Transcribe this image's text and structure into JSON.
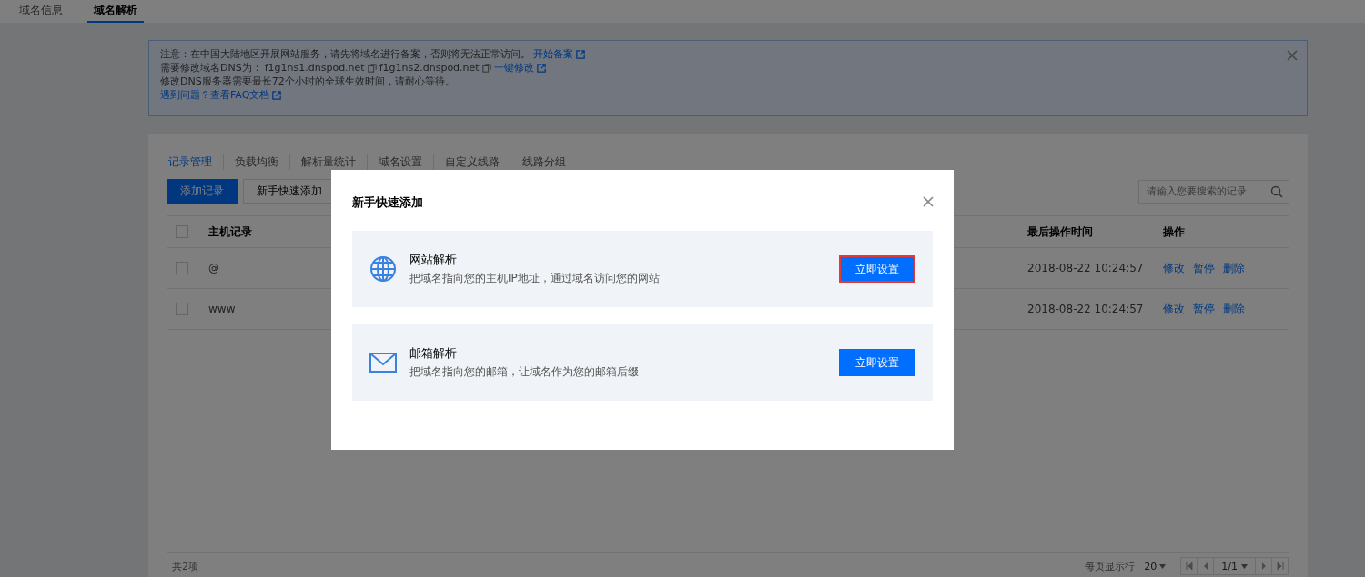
{
  "top_tabs": [
    {
      "label": "域名信息",
      "selected": false
    },
    {
      "label": "域名解析",
      "selected": true
    }
  ],
  "notice": {
    "lines": [
      {
        "text": "注意：在中国大陆地区开展网站服务，请先将域名进行备案，否则将无法正常访问。",
        "links": [
          "开始备案"
        ]
      },
      {
        "text": "需要修改域名DNS为：",
        "servers": [
          "f1g1ns1.dnspod.net",
          "f1g1ns2.dnspod.net"
        ],
        "links": [
          "一键修改"
        ]
      },
      {
        "text": "修改DNS服务器需要最长72个小时的全球生效时间，请耐心等待。"
      },
      {
        "links": [
          "遇到问题？查看FAQ文档"
        ]
      }
    ]
  },
  "sub_tabs": [
    {
      "label": "记录管理",
      "selected": true
    },
    {
      "label": "负载均衡",
      "selected": false
    },
    {
      "label": "解析量统计",
      "selected": false
    },
    {
      "label": "域名设置",
      "selected": false
    },
    {
      "label": "自定义线路",
      "selected": false
    },
    {
      "label": "线路分组",
      "selected": false
    }
  ],
  "toolbar": {
    "buttons": [
      {
        "label": "添加记录",
        "kind": "primary"
      },
      {
        "label": "新手快速添加",
        "kind": "default"
      }
    ],
    "search": {
      "placeholder": "请输入您要搜索的记录"
    }
  },
  "table": {
    "header_checked": false,
    "columns": [
      "主机记录",
      "最后操作时间",
      "操作"
    ],
    "rows": [
      {
        "checked": false,
        "host": "@",
        "time": "2018-08-22 10:24:57",
        "actions": [
          "修改",
          "暂停",
          "删除"
        ]
      },
      {
        "checked": false,
        "host": "www",
        "time": "2018-08-22 10:24:57",
        "actions": [
          "修改",
          "暂停",
          "删除"
        ]
      }
    ]
  },
  "footer": {
    "total": "共2项",
    "page_size_label": "每页显示行",
    "page_size": "20",
    "page": "1/1"
  },
  "dialog": {
    "title": "新手快速添加",
    "options": [
      {
        "kind": "website",
        "title": "网站解析",
        "description": "把域名指向您的主机IP地址，通过域名访问您的网站",
        "button": "立即设置",
        "highlighted": true
      },
      {
        "kind": "mail",
        "title": "邮箱解析",
        "description": "把域名指向您的邮箱，让域名作为您的邮箱后缀",
        "button": "立即设置",
        "highlighted": false
      }
    ]
  }
}
